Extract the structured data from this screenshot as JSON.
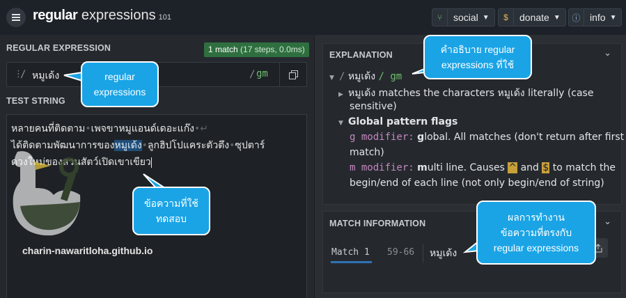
{
  "header": {
    "brand_bold": "regular",
    "brand_rest": "expressions",
    "brand_sub": "101",
    "nav": [
      {
        "label": "social",
        "icon": "share-icon"
      },
      {
        "label": "donate",
        "icon": "dollar-icon"
      },
      {
        "label": "info",
        "icon": "info-icon"
      }
    ]
  },
  "regex": {
    "section_title": "REGULAR EXPRESSION",
    "match_count": "1 match",
    "match_detail": "(17 steps, 0.0ms)",
    "delimiter_open": "/",
    "pattern": "หมูเด้ง",
    "delimiter_close": "/",
    "flags": "gm"
  },
  "test": {
    "section_title": "TEST STRING",
    "line1": "หลายคนที่ติดตาม",
    "line1b": "เพจขาหมูแอนด์เดอะแก๊ง",
    "line2a": "ได้ติดตามพัฒนาการของ",
    "line2_match": "หมูเด้ง",
    "line2b": "ลูกฮิปโปแคระตัวตึง",
    "line2c": "ซุปตาร์",
    "line3": "ดวงใหม่ของสวนสัตว์เปิดเขาเขียว",
    "space_marker": "•",
    "newline_marker": "↵"
  },
  "watermark": "charin-nawaritloha.github.io",
  "explanation": {
    "section_title": "EXPLANATION",
    "root_delim": "/",
    "root_pattern": "หมูเด้ง",
    "root_flags": "/ gm",
    "item_line1": "หมูเด้ง matches the characters หมูเด้ง literally (case",
    "item_line2": "sensitive)",
    "flags_title": "Global pattern flags",
    "g_mod": "g modifier:",
    "g_bold": "g",
    "g_text": "lobal. All matches (don't return after first",
    "g_text2": "match)",
    "m_mod": "m modifier:",
    "m_bold": "m",
    "m_text1": "ulti line. Causes",
    "m_caret": "^",
    "m_and": "and",
    "m_dollar": "$",
    "m_text2": "to match the",
    "m_text3": "begin/end of each line (not only begin/end of string)"
  },
  "match_info": {
    "section_title": "MATCH INFORMATION",
    "match_label": "Match 1",
    "range": "59-66",
    "value": "หมูเด้ง"
  },
  "callouts": {
    "regex": [
      "regular",
      "expressions"
    ],
    "explain": [
      "คำอธิบาย regular",
      "expressions ที่ใช้"
    ],
    "test": [
      "ข้อความที่ใช้",
      "ทดสอบ"
    ],
    "result": [
      "ผลการทำงาน",
      "ข้อความที่ตรงกับ",
      "regular expressions"
    ]
  },
  "colors": {
    "callout": "#1aa4e6",
    "match_highlight": "#1f4e79",
    "flags": "#6fbf6f",
    "badge": "#2f6f3f"
  }
}
